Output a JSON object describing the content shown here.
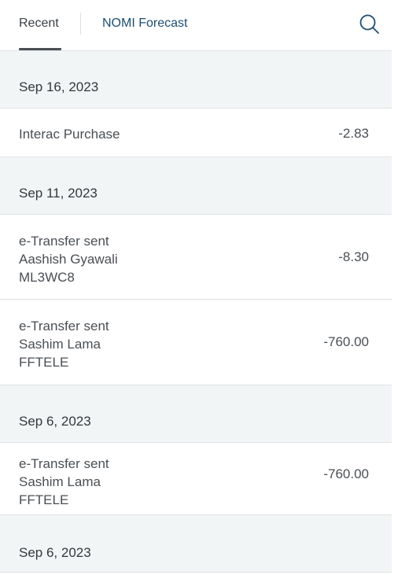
{
  "tabs": {
    "recent": "Recent",
    "nomi": "NOMI Forecast"
  },
  "groups": [
    {
      "date": "Sep 16, 2023",
      "transactions": [
        {
          "lines": [
            "Interac Purchase"
          ],
          "amount": "-2.83"
        }
      ]
    },
    {
      "date": "Sep 11, 2023",
      "transactions": [
        {
          "lines": [
            "e-Transfer sent",
            "Aashish Gyawali",
            "ML3WC8"
          ],
          "amount": "-8.30"
        },
        {
          "lines": [
            "e-Transfer sent",
            "Sashim Lama",
            "FFTELE"
          ],
          "amount": "-760.00"
        }
      ]
    },
    {
      "date": "Sep 6, 2023",
      "transactions": [
        {
          "lines": [
            "e-Transfer sent",
            "Sashim Lama",
            "FFTELE"
          ],
          "amount": "-760.00"
        }
      ]
    },
    {
      "date": "Sep 6, 2023",
      "transactions": []
    }
  ]
}
